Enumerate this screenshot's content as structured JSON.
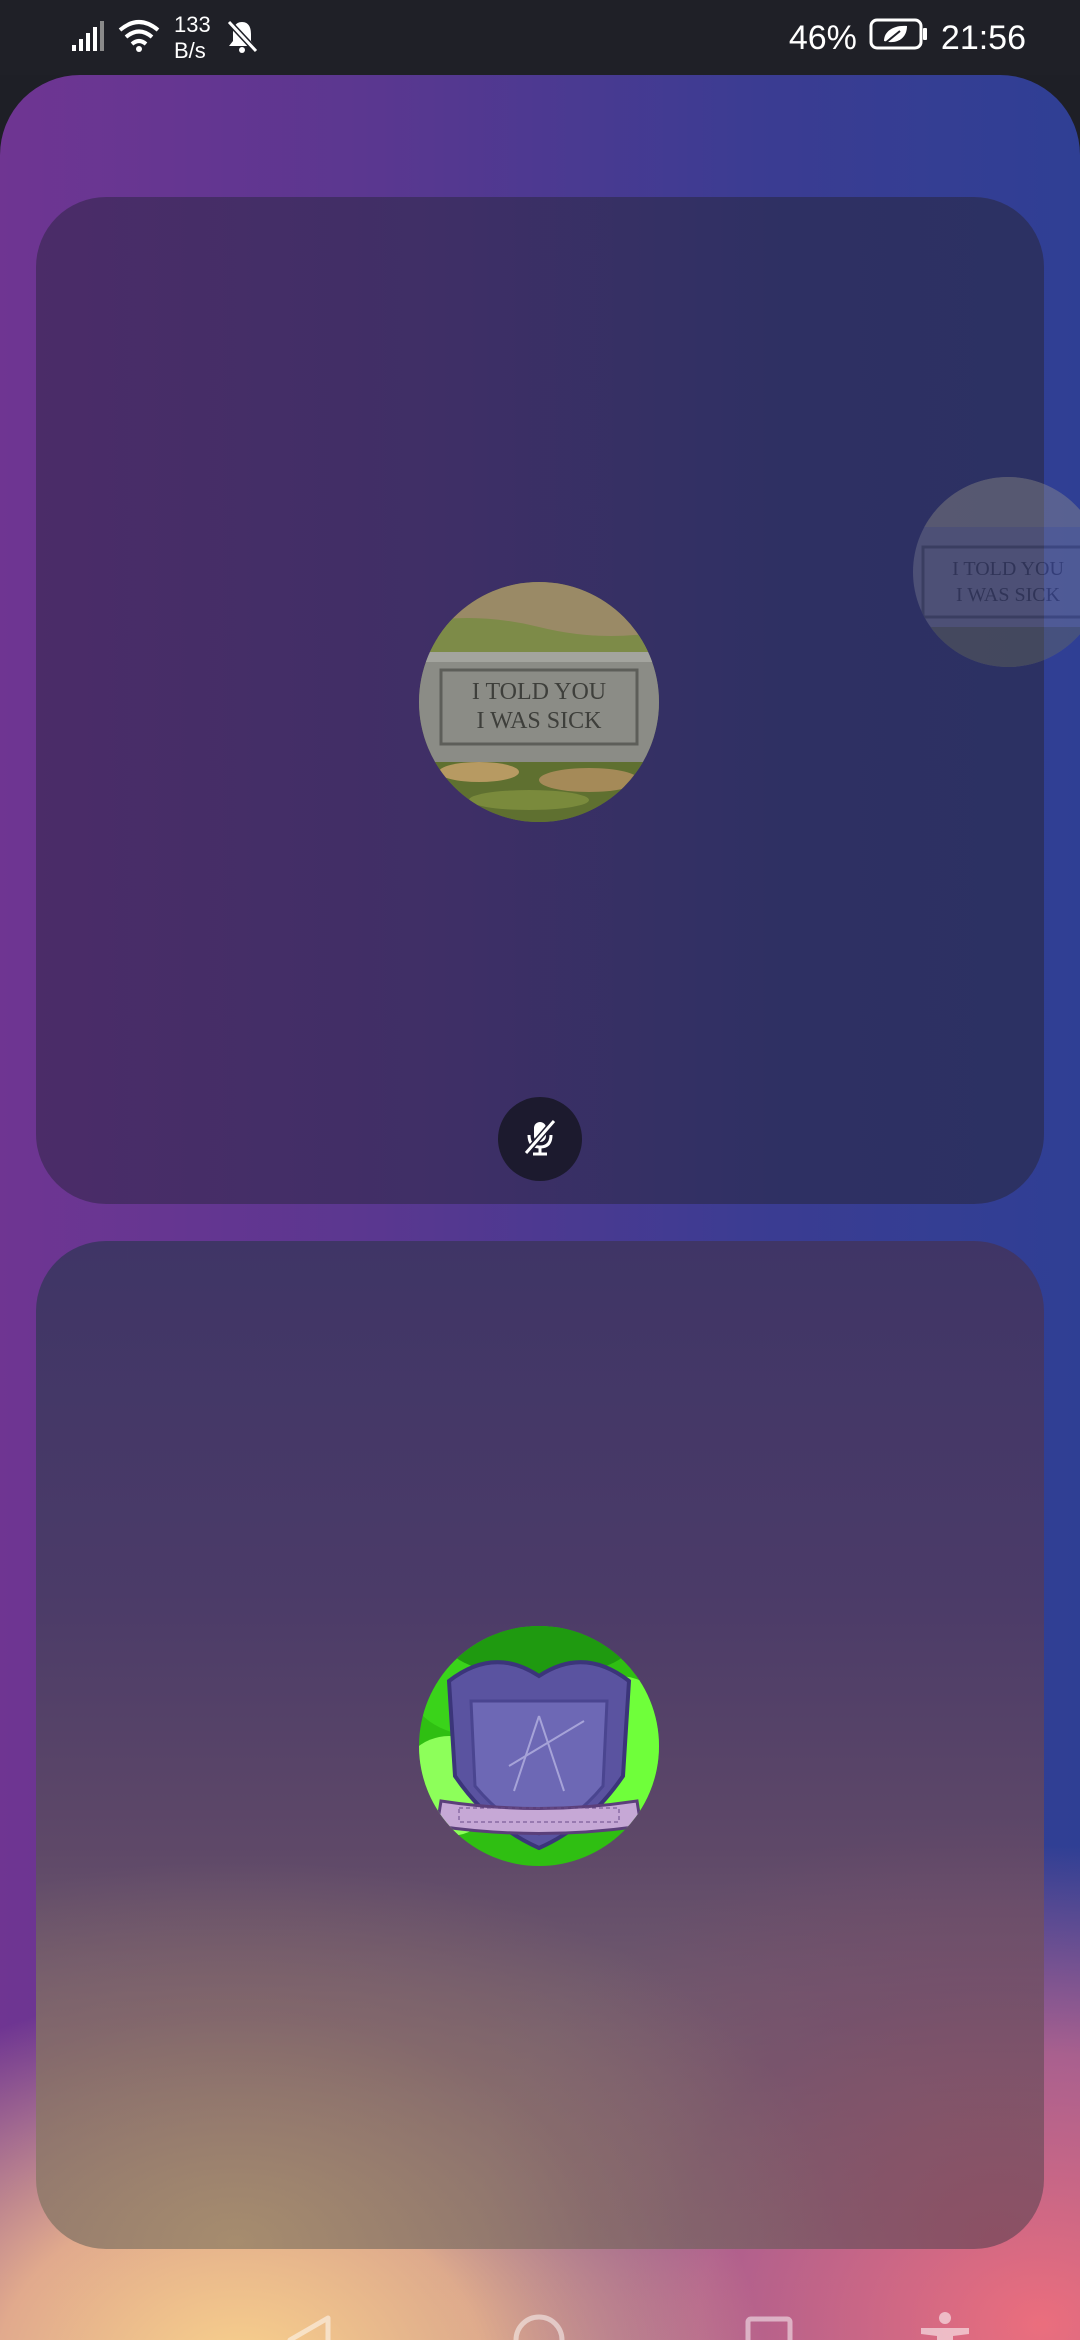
{
  "status_bar": {
    "network_speed_value": "133",
    "network_speed_unit": "B/s",
    "battery_percent": "46%",
    "time": "21:56",
    "icons": [
      "signal-icon",
      "wifi-icon",
      "notifications-off-icon",
      "battery-saver-icon"
    ]
  },
  "call": {
    "tile_top": {
      "avatar_image_text_line1": "I TOLD YOU",
      "avatar_image_text_line2": "I WAS SICK",
      "muted": true,
      "mute_icon": "microphone-off-icon"
    },
    "pip_avatar": {
      "image_text_line1": "I TOLD YOU",
      "image_text_line2": "I WAS SICK"
    },
    "tile_bottom": {
      "avatar_emblem": "shield-crest-icon"
    }
  },
  "nav_bar": {
    "icons": [
      "back-icon",
      "home-icon",
      "recents-icon",
      "accessibility-icon"
    ]
  },
  "colors": {
    "status_bar_bg": "#1f2027",
    "purple_left": "#6f3592",
    "blue_right": "#2f3f94",
    "peach_bottom": "#f5c98c",
    "pink_bottom": "#e57a85",
    "mute_badge_bg": "#1c1a2e",
    "avatar_green": "#3ad31a"
  }
}
